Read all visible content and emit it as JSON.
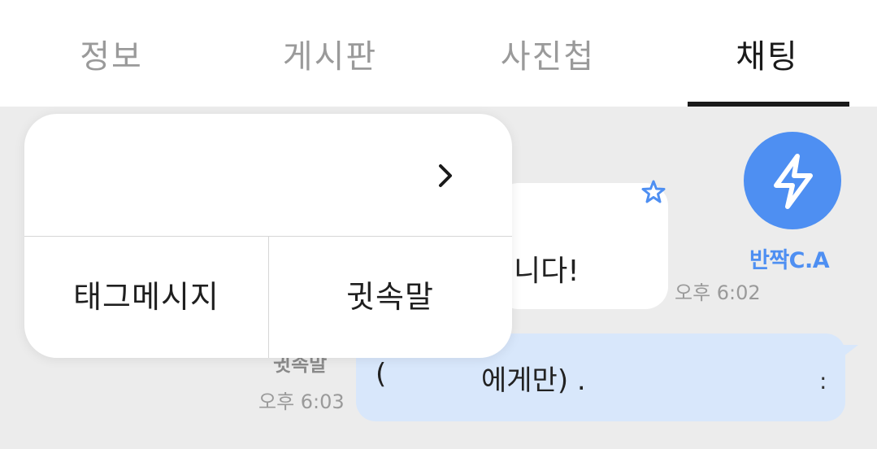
{
  "tabs": [
    {
      "label": "정보"
    },
    {
      "label": "게시판"
    },
    {
      "label": "사진첩"
    },
    {
      "label": "채팅",
      "active": true
    }
  ],
  "chat": {
    "incoming": {
      "text": "니다!",
      "time": "오후 6:02",
      "sender": "반짝C.A",
      "icons": [
        "star-outline-icon",
        "lightning-icon"
      ]
    },
    "outgoing": {
      "label": "귓속말",
      "text_open": "(",
      "text": "에게만) .",
      "text_tail": ":",
      "time": "오후 6:03"
    }
  },
  "popup": {
    "header_icon": "chevron-right-icon",
    "actions": [
      {
        "label": "태그메시지"
      },
      {
        "label": "귓속말"
      }
    ]
  },
  "colors": {
    "accent": "#4e8ff2",
    "outgoing_bubble": "#d8e7fb",
    "background": "#ececec"
  }
}
